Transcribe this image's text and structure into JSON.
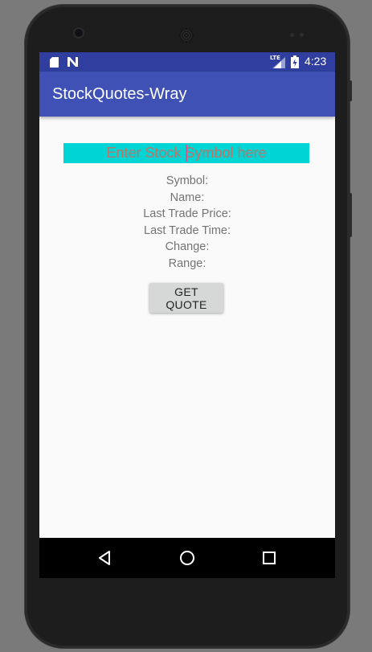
{
  "status_bar": {
    "time": "4:23",
    "network": "LTE",
    "icons": [
      "sd-card-icon",
      "n-notification-icon",
      "signal-icon",
      "battery-charging-icon"
    ]
  },
  "app_bar": {
    "title": "StockQuotes-Wray"
  },
  "form": {
    "symbol_input": {
      "value": "",
      "placeholder": "Enter Stock Symbol here"
    },
    "labels": {
      "symbol": "Symbol:",
      "name": "Name:",
      "last_trade_price": "Last Trade Price:",
      "last_trade_time": "Last Trade Time:",
      "change": "Change:",
      "range": "Range:"
    },
    "get_quote_label": "GET QUOTE"
  },
  "nav_bar": {
    "icons": [
      "back-icon",
      "home-icon",
      "recents-icon"
    ]
  },
  "colors": {
    "status_bar": "#303f9f",
    "app_bar": "#3f51b5",
    "input_background": "#00d4d4",
    "screen_background": "#fafafa"
  }
}
